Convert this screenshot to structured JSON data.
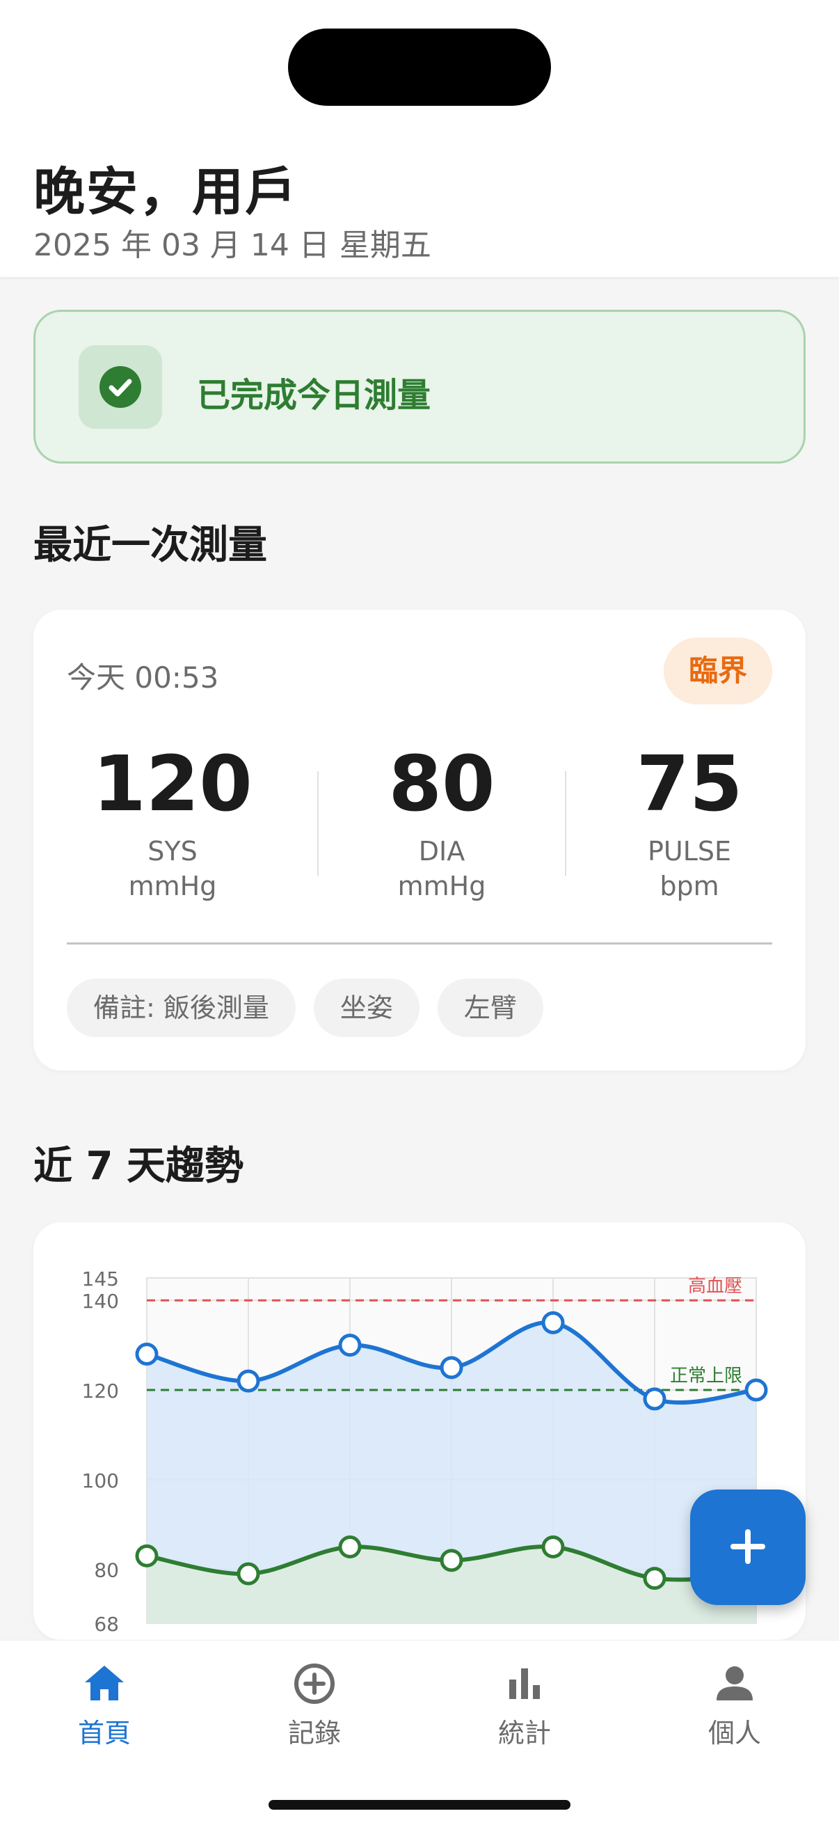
{
  "header": {
    "greeting": "晚安，用戶",
    "date": "2025 年 03 月 14 日 星期五"
  },
  "done_banner": {
    "text": "已完成今日測量",
    "icon": "check-circle-icon"
  },
  "latest": {
    "section_title": "最近一次測量",
    "time": "今天 00:53",
    "status": "臨界",
    "metrics": [
      {
        "value": "120",
        "label": "SYS",
        "unit": "mmHg"
      },
      {
        "value": "80",
        "label": "DIA",
        "unit": "mmHg"
      },
      {
        "value": "75",
        "label": "PULSE",
        "unit": "bpm"
      }
    ],
    "tags": [
      "備註: 飯後測量",
      "坐姿",
      "左臂"
    ]
  },
  "trend": {
    "section_title": "近 7 天趨勢"
  },
  "chart_data": {
    "type": "line",
    "y_ticks": [
      "145",
      "140",
      "120",
      "100",
      "80",
      "68"
    ],
    "ylim": [
      68,
      145
    ],
    "grid": true,
    "series": [
      {
        "values": [
          128,
          122,
          130,
          125,
          135,
          118,
          120
        ],
        "color": "#1e74d2",
        "fill": "#d6e6f8"
      },
      {
        "values": [
          83,
          79,
          85,
          82,
          85,
          78,
          79
        ],
        "color": "#2e7d32",
        "fill": "#dcecdf"
      }
    ],
    "reference_lines": [
      {
        "value": 140,
        "label": "高血壓",
        "color": "#e05252"
      },
      {
        "value": 120,
        "label": "正常上限",
        "color": "#2e7d32"
      }
    ]
  },
  "fab": {
    "icon": "plus-icon"
  },
  "nav": {
    "items": [
      {
        "label": "首頁",
        "icon": "home-icon",
        "active": true
      },
      {
        "label": "記錄",
        "icon": "add-circle-icon",
        "active": false
      },
      {
        "label": "統計",
        "icon": "bar-chart-icon",
        "active": false
      },
      {
        "label": "個人",
        "icon": "person-icon",
        "active": false
      }
    ]
  }
}
